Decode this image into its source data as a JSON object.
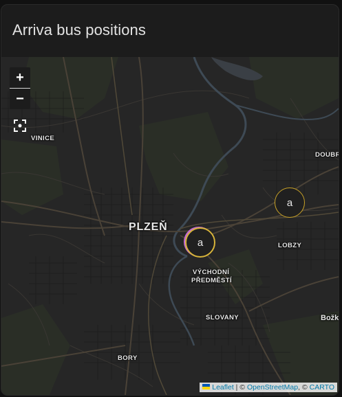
{
  "card": {
    "title": "Arriva bus positions"
  },
  "controls": {
    "zoom_in": "+",
    "zoom_out": "−"
  },
  "labels": {
    "vinice": "VINICE",
    "plzen": "PLZEŇ",
    "doubr": "DOUBR",
    "lobzy": "LOBZY",
    "vychodni_1": "VÝCHODNÍ",
    "vychodni_2": "PŘEDMĚSTÍ",
    "slovany": "SLOVANY",
    "bozkov": "Božk",
    "bory": "BORY"
  },
  "markers": [
    {
      "text": "a",
      "ring_color": "#c9a227"
    },
    {
      "text": "a",
      "ring_color": "#d7b43a"
    }
  ],
  "attribution": {
    "leaflet": "Leaflet",
    "sep1": " | © ",
    "osm": "OpenStreetMap",
    "sep2": ", © ",
    "carto": "CARTO"
  }
}
